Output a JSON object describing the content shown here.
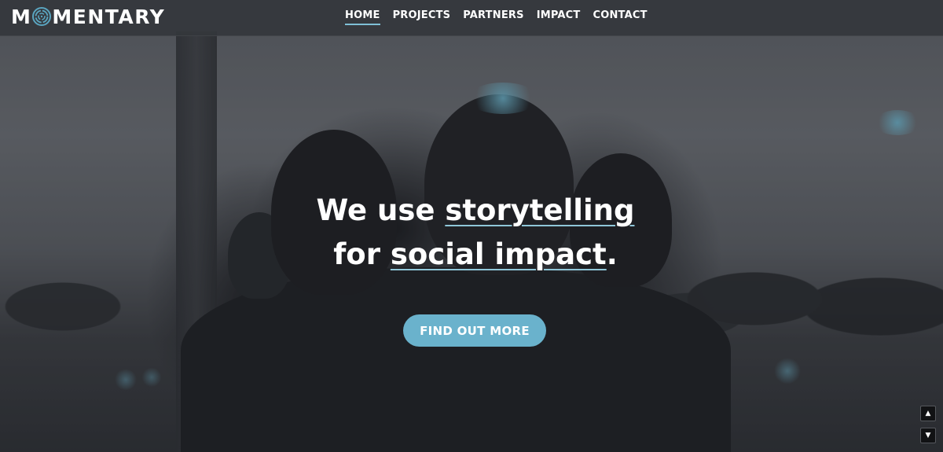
{
  "header": {
    "logo_left": "M",
    "logo_right": "MENTARY",
    "logo_accent": "#5aa5c0"
  },
  "nav": {
    "items": [
      {
        "label": "HOME",
        "active": true
      },
      {
        "label": "PROJECTS",
        "active": false
      },
      {
        "label": "PARTNERS",
        "active": false
      },
      {
        "label": "IMPACT",
        "active": false
      },
      {
        "label": "CONTACT",
        "active": false
      }
    ]
  },
  "hero": {
    "line1_plain": "We use ",
    "line1_link": "storytelling",
    "line2_plain": "for ",
    "line2_link": "social impact",
    "line2_end": ".",
    "cta_label": "FIND OUT MORE"
  },
  "scroll": {
    "up_icon": "▲",
    "down_icon": "▼"
  },
  "colors": {
    "accent": "#6ab2cc",
    "underline": "#8fc6d8",
    "header_bg": "#34373c"
  }
}
